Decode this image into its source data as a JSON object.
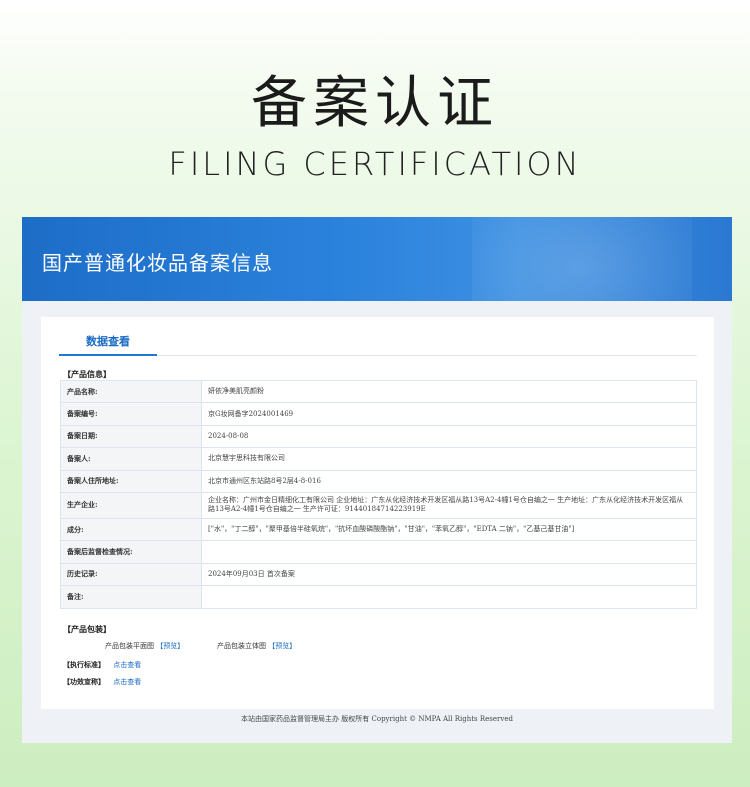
{
  "hero": {
    "title": "备案认证",
    "subtitle": "FILING CERTIFICATION"
  },
  "banner": {
    "title": "国产普通化妆品备案信息"
  },
  "tabs": [
    {
      "label": "数据查看"
    }
  ],
  "product_info": {
    "section_label": "【产品信息】",
    "rows": [
      {
        "key": "产品名称:",
        "value": "妍依净美肌亮颜粉"
      },
      {
        "key": "备案编号:",
        "value": "京G妆网备字2024001469"
      },
      {
        "key": "备案日期:",
        "value": "2024-08-08"
      },
      {
        "key": "备案人:",
        "value": "北京慧宇思科技有限公司"
      },
      {
        "key": "备案人住所地址:",
        "value": "北京市通州区东站路8号2层4-8-016"
      },
      {
        "key": "生产企业:",
        "value": "企业名称：广州市金日精细化工有限公司 企业地址：广东从化经济技术开发区福从路13号A2-4幢1号仓自编之一 生产地址：广东从化经济技术开发区福从路13号A2-4幢1号仓自编之一 生产许可证：91440184714223919E"
      },
      {
        "key": "成分:",
        "value": "[\"水\"，\"丁二醇\"，\"聚甲基倍半硅氧烷\"，\"抗坏血酸磷酸酯钠\"，\"甘油\"，\"苯氧乙醇\"，\"EDTA 二钠\"，\"乙基己基甘油\"]"
      },
      {
        "key": "备案后监督检查情况:",
        "value": ""
      },
      {
        "key": "历史记录:",
        "value": "2024年09月03日 首次备案"
      },
      {
        "key": "备注:",
        "value": ""
      }
    ]
  },
  "packaging": {
    "section_label": "【产品包装】",
    "flat_label": "产品包装平面图",
    "flat_link": "【预览】",
    "solid_label": "产品包装立体图",
    "solid_link": "【预览】"
  },
  "standard": {
    "label": "【执行标准】",
    "link": "点击查看"
  },
  "efficacy": {
    "label": "【功效宣称】",
    "link": "点击查看"
  },
  "footer": {
    "text": "本站由国家药品监督管理局主办 版权所有 Copyright © NMPA All Rights Reserved"
  }
}
